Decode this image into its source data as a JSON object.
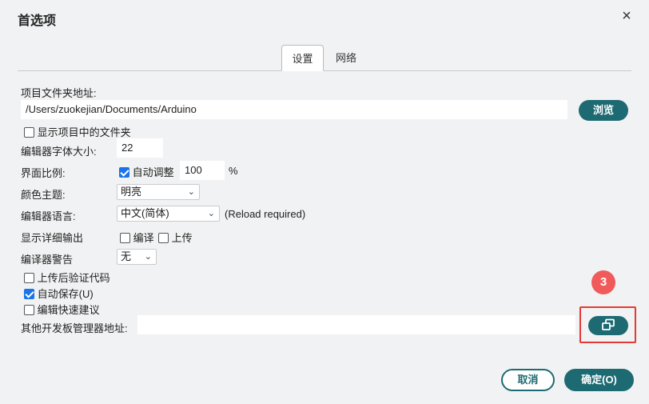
{
  "dialog": {
    "title": "首选项",
    "close_icon": "×"
  },
  "tabs": [
    {
      "label": "设置",
      "active": true
    },
    {
      "label": "网络",
      "active": false
    }
  ],
  "settings": {
    "project_folder_label": "项目文件夹地址:",
    "project_folder_value": "/Users/zuokejian/Documents/Arduino",
    "browse_label": "浏览",
    "show_files_label": "显示项目中的文件夹",
    "show_files_checked": false,
    "font_size_label": "编辑器字体大小:",
    "font_size_value": "22",
    "scale_label": "界面比例:",
    "auto_adjust_label": "自动调整",
    "auto_adjust_checked": true,
    "scale_value": "100",
    "scale_unit": "%",
    "theme_label": "颜色主题:",
    "theme_value": "明亮",
    "language_label": "编辑器语言:",
    "language_value": "中文(简体)",
    "reload_note": "(Reload required)",
    "verbose_label": "显示详细输出",
    "verbose_compile_label": "编译",
    "verbose_compile_checked": false,
    "verbose_upload_label": "上传",
    "verbose_upload_checked": false,
    "warnings_label": "编译器警告",
    "warnings_value": "无",
    "verify_label": "上传后验证代码",
    "verify_checked": false,
    "autosave_label": "自动保存(U)",
    "autosave_checked": true,
    "quick_suggest_label": "编辑快速建议",
    "quick_suggest_checked": false,
    "board_urls_label": "其他开发板管理器地址:",
    "board_urls_value": ""
  },
  "annotation": {
    "badge_number": "3",
    "highlight_color": "#e53935"
  },
  "footer": {
    "cancel_label": "取消",
    "ok_label": "确定(O)"
  },
  "colors": {
    "accent": "#1d6a72",
    "checkbox": "#1a73e8",
    "badge": "#f05a5a",
    "background": "#f1f2f3"
  },
  "icons": {
    "close": "close-icon",
    "chevron": "chevron-down-icon",
    "open_window": "external-window-icon",
    "check": "check-icon"
  }
}
